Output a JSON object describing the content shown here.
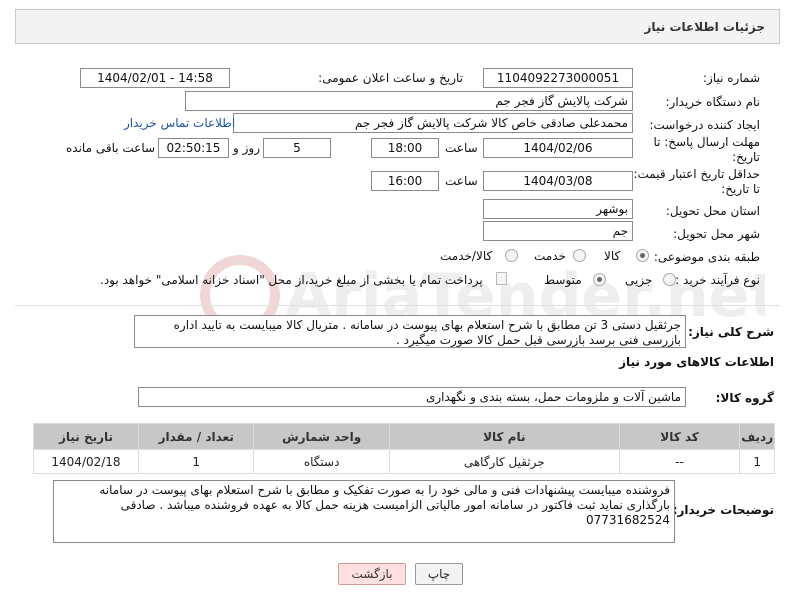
{
  "header": {
    "title": "جزئیات اطلاعات نیاز"
  },
  "fields": {
    "need_number_label": "شماره نیاز:",
    "need_number": "1104092273000051",
    "announce_label": "تاریخ و ساعت اعلان عمومی:",
    "announce_value": "1404/02/01 - 14:58",
    "buyer_org_label": "نام دستگاه خریدار:",
    "buyer_org": "شرکت پالایش گاز فجر جم",
    "requester_label": "ایجاد کننده درخواست:",
    "requester": "محمدعلی صادقی خاص کالا شرکت پالایش گاز فجر جم",
    "contact_link": "اطلاعات تماس خریدار",
    "deadline_label_1": "مهلت ارسال پاسخ: تا",
    "deadline_label_2": "تاریخ:",
    "deadline_date": "1404/02/06",
    "time_label": "ساعت",
    "deadline_time": "18:00",
    "days_value": "5",
    "days_label": "روز و",
    "remaining_time": "02:50:15",
    "remaining_label": "ساعت باقی مانده",
    "validity_label_1": "حداقل تاریخ اعتبار قیمت:",
    "validity_label_2": "تا تاریخ:",
    "validity_date": "1404/03/08",
    "validity_time_label": "ساعت",
    "validity_time": "16:00",
    "province_label": "استان محل تحویل:",
    "province": "بوشهر",
    "city_label": "شهر محل تحویل:",
    "city": "جم",
    "category_label": "طبقه بندی موضوعی:",
    "category_options": [
      "کالا",
      "خدمت",
      "کالا/خدمت"
    ],
    "category_selected": "کالا",
    "process_label": "نوع فرآیند خرید :",
    "process_options": [
      "جزیی",
      "متوسط"
    ],
    "process_selected": "متوسط",
    "payment_text": "پرداخت تمام یا بخشی از مبلغ خرید،از محل \"اسناد خزانه اسلامی\" خواهد بود."
  },
  "description": {
    "label": "شرح کلی نیاز:",
    "text": "جرثقیل دستی 3 تن مطابق با شرح استعلام بهای پیوست در سامانه . متریال کالا میبایست به تایید اداره بازرسی فنی برسد بازرسی قبل حمل کالا صورت میگیرد ."
  },
  "goods_section": {
    "title": "اطلاعات کالاهای مورد نیاز",
    "group_label": "گروه کالا:",
    "group_value": "ماشین آلات و ملزومات حمل، بسته بندی و نگهداری"
  },
  "table": {
    "headers": [
      "ردیف",
      "کد کالا",
      "نام کالا",
      "واحد شمارش",
      "تعداد / مقدار",
      "تاریخ نیاز"
    ],
    "rows": [
      [
        "1",
        "--",
        "جرثقیل کارگاهی",
        "دستگاه",
        "1",
        "1404/02/18"
      ]
    ]
  },
  "buyer_notes": {
    "label": "توضیحات خریدار:",
    "text": "فروشنده میبایست پیشنهادات فنی و مالی خود را به صورت تفکیک و مطابق با شرح استعلام بهای پیوست در سامانه بارگذاری نماید ثبت فاکتور در سامانه امور مالیاتی الزامیست هزینه حمل کالا به عهده فروشنده میباشد . صادقی 07731682524"
  },
  "buttons": {
    "print": "چاپ",
    "back": "بازگشت"
  },
  "watermark_text": "AriaTender.net",
  "colors": {
    "link": "#1a56a8",
    "table_header": "#c7c7c7",
    "back_button": "#ffe0e0"
  }
}
